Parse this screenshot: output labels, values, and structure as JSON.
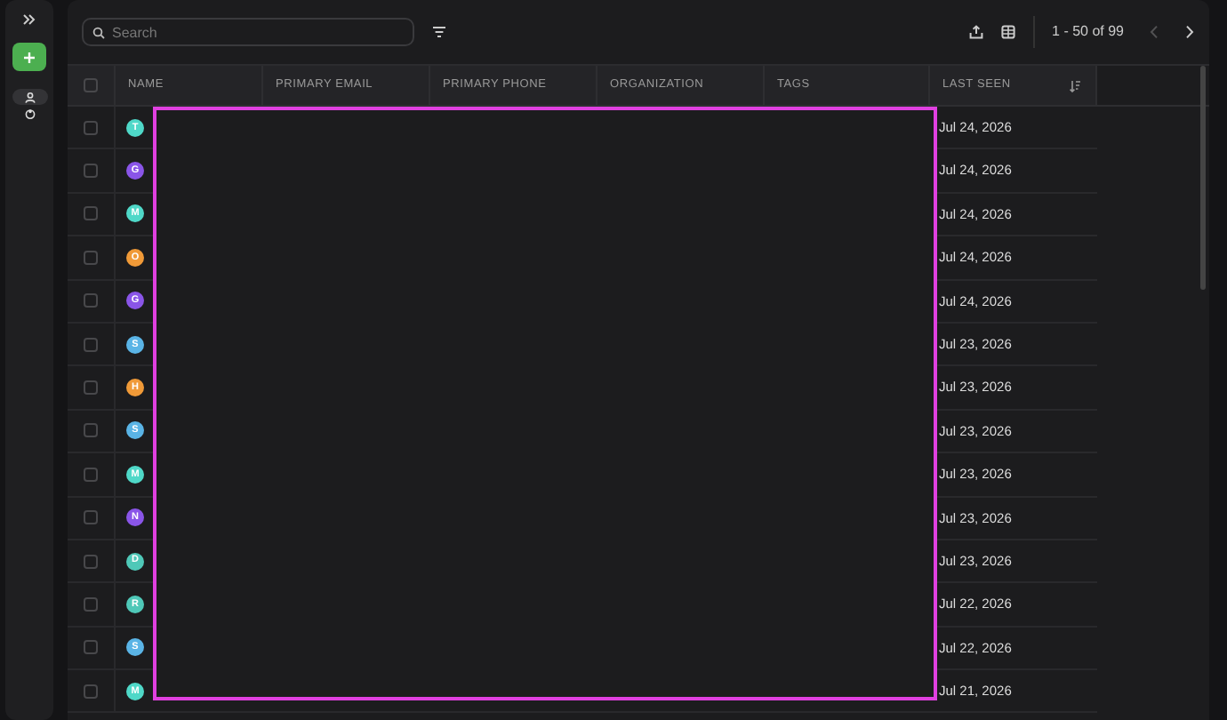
{
  "search": {
    "placeholder": "Search"
  },
  "pagination": {
    "range": "1 - 50 of 99",
    "prev_disabled": true,
    "next_disabled": false
  },
  "table": {
    "select_all_checked": false,
    "columns": [
      "NAME",
      "PRIMARY EMAIL",
      "PRIMARY PHONE",
      "ORGANIZATION",
      "TAGS",
      "LAST SEEN"
    ],
    "rows": [
      {
        "initial": "T",
        "color": "#4fd8c8",
        "last_seen": "Jul 24, 2026",
        "checked": false
      },
      {
        "initial": "G",
        "color": "#8a55e8",
        "last_seen": "Jul 24, 2026",
        "checked": false
      },
      {
        "initial": "M",
        "color": "#4fd8c8",
        "last_seen": "Jul 24, 2026",
        "checked": false
      },
      {
        "initial": "O",
        "color": "#f09a38",
        "last_seen": "Jul 24, 2026",
        "checked": false
      },
      {
        "initial": "G",
        "color": "#8a55e8",
        "last_seen": "Jul 24, 2026",
        "checked": false
      },
      {
        "initial": "S",
        "color": "#5ab4e6",
        "last_seen": "Jul 23, 2026",
        "checked": false
      },
      {
        "initial": "H",
        "color": "#f09a38",
        "last_seen": "Jul 23, 2026",
        "checked": false
      },
      {
        "initial": "S",
        "color": "#5ab4e6",
        "last_seen": "Jul 23, 2026",
        "checked": false
      },
      {
        "initial": "M",
        "color": "#4fd8c8",
        "last_seen": "Jul 23, 2026",
        "checked": false
      },
      {
        "initial": "N",
        "color": "#8a55e8",
        "last_seen": "Jul 23, 2026",
        "checked": false
      },
      {
        "initial": "D",
        "color": "#4fc8b8",
        "last_seen": "Jul 23, 2026",
        "checked": false
      },
      {
        "initial": "R",
        "color": "#4fc8b8",
        "last_seen": "Jul 22, 2026",
        "checked": false
      },
      {
        "initial": "S",
        "color": "#5ab4e6",
        "last_seen": "Jul 22, 2026",
        "checked": false
      },
      {
        "initial": "M",
        "color": "#4fd8c8",
        "last_seen": "Jul 21, 2026",
        "checked": false
      }
    ]
  }
}
